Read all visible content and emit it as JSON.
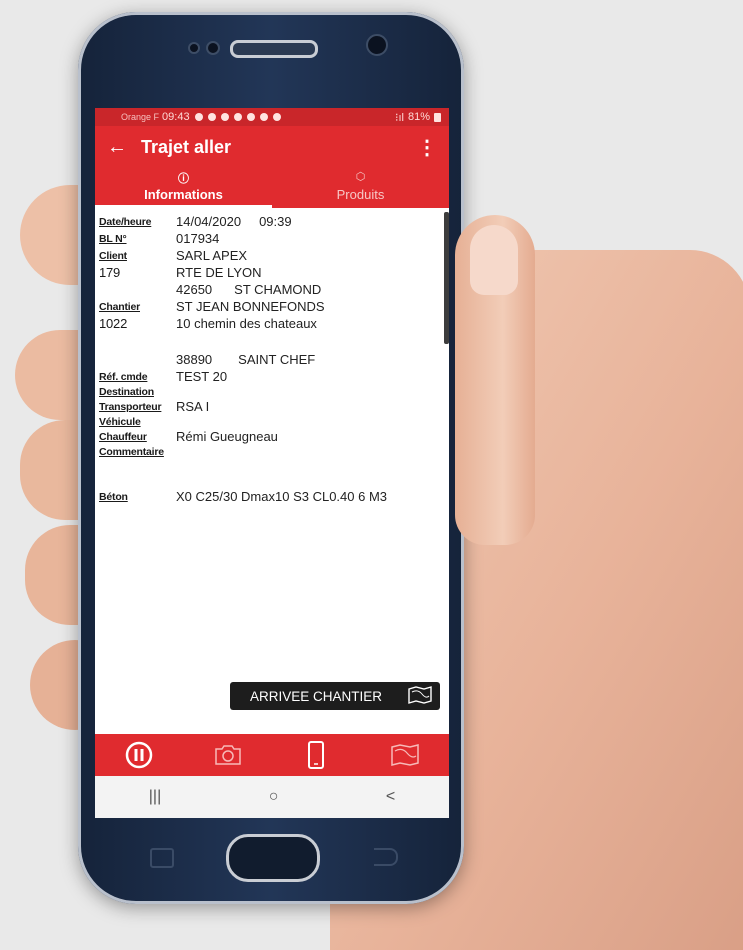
{
  "statusbar": {
    "carrier": "Orange F",
    "time": "09:43",
    "battery": "81%"
  },
  "appbar": {
    "title": "Trajet aller",
    "back_icon": "arrow-left-icon",
    "menu_icon": "more-vert-icon"
  },
  "tabs": [
    {
      "label": "Informations",
      "icon": "info-icon",
      "active": true
    },
    {
      "label": "Produits",
      "icon": "box-icon",
      "active": false
    }
  ],
  "details": {
    "date_label": "Date/heure",
    "date": "14/04/2020",
    "time": "09:39",
    "bl_label": "BL N°",
    "bl": "017934",
    "client_label": "Client",
    "client_name": "SARL APEX",
    "client_code": "179",
    "client_street": "RTE DE LYON",
    "client_zip": "42650",
    "client_city": "ST CHAMOND",
    "chantier_label": "Chantier",
    "chantier_name": "ST JEAN BONNEFONDS",
    "chantier_code": "1022",
    "chantier_street": "10 chemin des chateaux",
    "chantier_zip": "38890",
    "chantier_city": "SAINT CHEF",
    "ref_label": "Réf. cmde",
    "ref": "TEST 20",
    "destination_label": "Destination",
    "transporteur_label": "Transporteur",
    "transporteur": "RSA I",
    "vehicule_label": "Véhicule",
    "chauffeur_label": "Chauffeur",
    "chauffeur": "Rémi Gueugneau",
    "commentaire_label": "Commentaire",
    "beton_label": "Béton",
    "beton": "X0 C25/30 Dmax10 S3 CL0.40 6 M3"
  },
  "action_button": {
    "label": "ARRIVEE CHANTIER",
    "icon": "map-icon"
  },
  "bottom_actions": [
    {
      "icon": "pause-icon"
    },
    {
      "icon": "camera-icon"
    },
    {
      "icon": "phone-icon"
    },
    {
      "icon": "map-icon"
    }
  ],
  "navbar": {
    "recent": "|||",
    "home": "○",
    "back": "<"
  },
  "colors": {
    "primary": "#e02b2f",
    "status": "#c9262a",
    "button_dark": "#1d1d1d"
  }
}
